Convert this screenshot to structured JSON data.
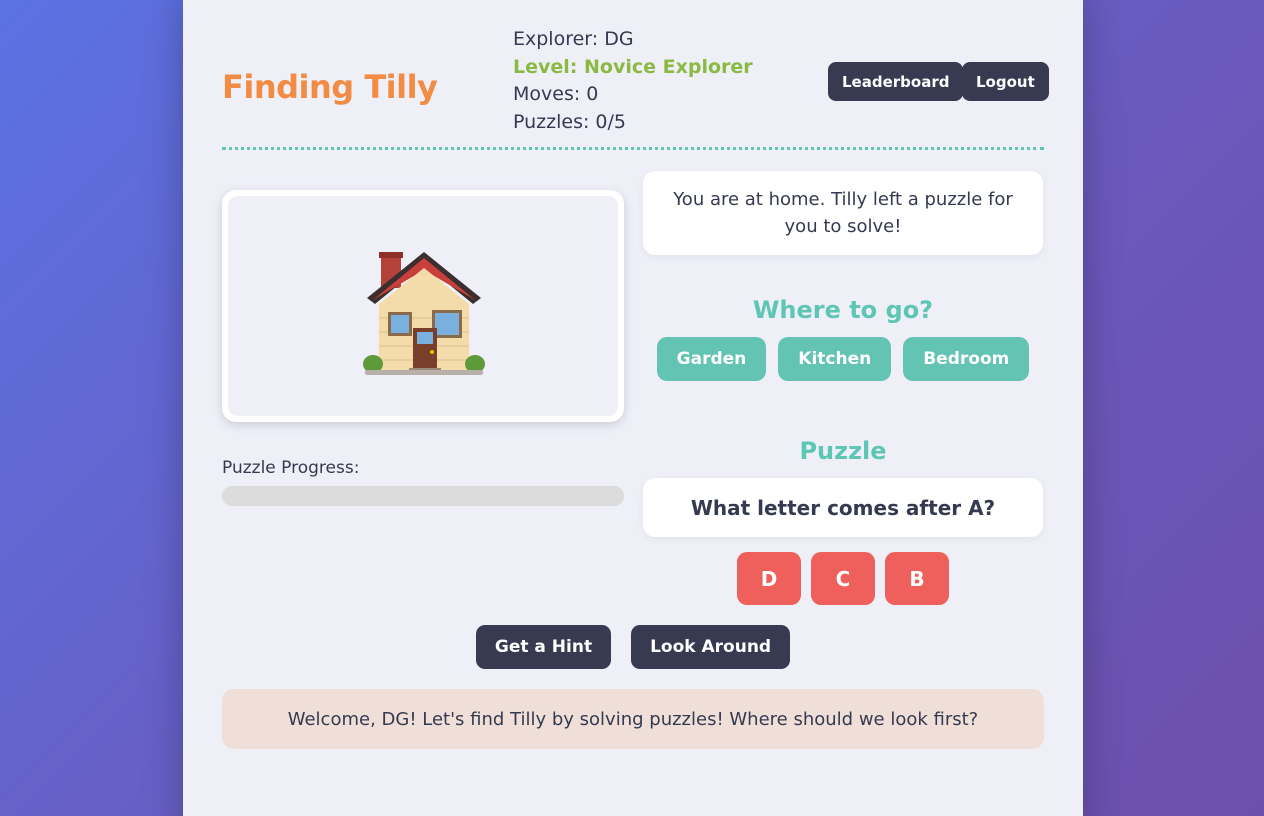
{
  "header": {
    "title": "Finding Tilly",
    "explorer": "Explorer: DG",
    "level": "Level: Novice Explorer",
    "moves": "Moves: 0",
    "puzzles": "Puzzles: 0/5",
    "leaderboard_label": "Leaderboard",
    "logout_label": "Logout"
  },
  "scene": {
    "icon": "house-icon",
    "description": "You are at home. Tilly left a puzzle for you to solve!"
  },
  "progress": {
    "label": "Puzzle Progress:",
    "value": 0
  },
  "navigation": {
    "title": "Where to go?",
    "options": [
      "Garden",
      "Kitchen",
      "Bedroom"
    ]
  },
  "puzzle": {
    "title": "Puzzle",
    "question": "What letter comes after A?",
    "answers": [
      "D",
      "C",
      "B"
    ]
  },
  "actions": {
    "hint_label": "Get a Hint",
    "look_label": "Look Around"
  },
  "message": "Welcome, DG! Let's find Tilly by solving puzzles! Where should we look first?",
  "colors": {
    "accent": "#5ec6b4",
    "title": "#f28c45",
    "level": "#8bba43",
    "answer": "#ef5f5c",
    "dark_button": "#373a51"
  }
}
